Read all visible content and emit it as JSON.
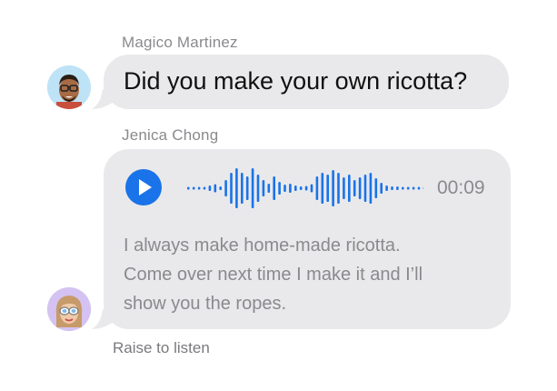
{
  "messages": [
    {
      "sender": "Magico Martinez",
      "text": "Did you make your own ricotta?",
      "avatar_icon": "memoji-man-glasses-icon"
    },
    {
      "sender": "Jenica Chong",
      "type": "audio",
      "duration": "00:09",
      "transcript_lines": [
        "I always make home-made ricotta.",
        "Come over next time I make it and I’ll",
        "show you the ropes."
      ],
      "avatar_icon": "memoji-woman-sunglasses-icon"
    }
  ],
  "hint": "Raise to listen",
  "colors": {
    "accent": "#1a73e8",
    "bubble": "#e9e9eb",
    "secondary_text": "#8a8a8e"
  }
}
